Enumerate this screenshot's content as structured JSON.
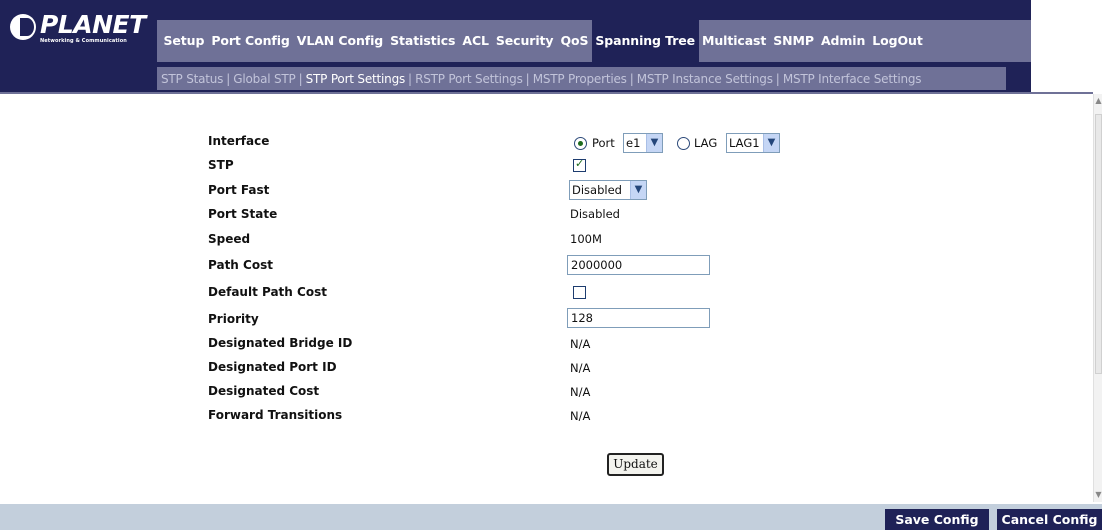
{
  "brand": {
    "name": "PLANET",
    "tagline": "Networking & Communication"
  },
  "main_nav": [
    {
      "label": "Setup",
      "active": false
    },
    {
      "label": "Port Config",
      "active": false
    },
    {
      "label": "VLAN Config",
      "active": false
    },
    {
      "label": "Statistics",
      "active": false
    },
    {
      "label": "ACL",
      "active": false
    },
    {
      "label": "Security",
      "active": false
    },
    {
      "label": "QoS",
      "active": false
    },
    {
      "label": "Spanning Tree",
      "active": true
    },
    {
      "label": "Multicast",
      "active": false
    },
    {
      "label": "SNMP",
      "active": false
    },
    {
      "label": "Admin",
      "active": false
    },
    {
      "label": "LogOut",
      "active": false
    }
  ],
  "sub_nav": [
    {
      "label": "STP Status",
      "active": false
    },
    {
      "label": "Global STP",
      "active": false
    },
    {
      "label": "STP Port Settings",
      "active": true
    },
    {
      "label": "RSTP Port Settings",
      "active": false
    },
    {
      "label": "MSTP Properties",
      "active": false
    },
    {
      "label": "MSTP Instance Settings",
      "active": false
    },
    {
      "label": "MSTP Interface Settings",
      "active": false
    }
  ],
  "form": {
    "interface": {
      "label": "Interface",
      "port_label": "Port",
      "port_value": "e1",
      "lag_label": "LAG",
      "lag_value": "LAG1",
      "selected": "port"
    },
    "stp": {
      "label": "STP",
      "checked": true
    },
    "port_fast": {
      "label": "Port Fast",
      "value": "Disabled"
    },
    "port_state": {
      "label": "Port State",
      "value": "Disabled"
    },
    "speed": {
      "label": "Speed",
      "value": "100M"
    },
    "path_cost": {
      "label": "Path Cost",
      "value": "2000000"
    },
    "default_path_cost": {
      "label": "Default Path Cost",
      "checked": false
    },
    "priority": {
      "label": "Priority",
      "value": "128"
    },
    "designated_bridge_id": {
      "label": "Designated Bridge ID",
      "value": "N/A"
    },
    "designated_port_id": {
      "label": "Designated Port ID",
      "value": "N/A"
    },
    "designated_cost": {
      "label": "Designated Cost",
      "value": "N/A"
    },
    "forward_transitions": {
      "label": "Forward Transitions",
      "value": "N/A"
    },
    "update_label": "Update"
  },
  "footer": {
    "save_label": "Save Config",
    "cancel_label": "Cancel Config"
  },
  "colors": {
    "header_dark": "#1f2257",
    "nav_bar": "#6f7197",
    "footer_bar": "#c3cfdc"
  }
}
